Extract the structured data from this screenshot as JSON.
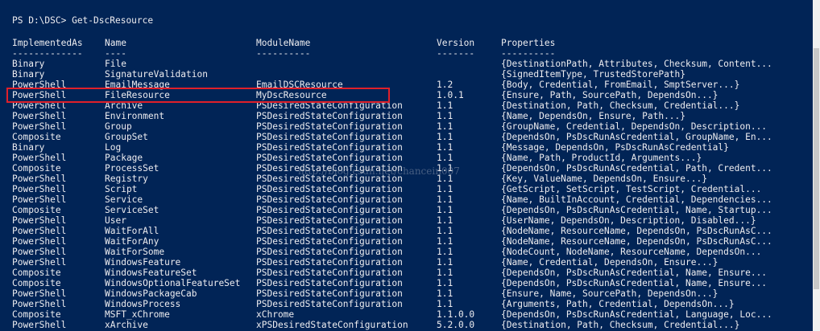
{
  "console": {
    "prompt": "PS D:\\DSC> Get-DscResource",
    "headers": [
      "ImplementedAs",
      "Name",
      "ModuleName",
      "Version",
      "Properties"
    ],
    "underlines": [
      "-------------",
      "----",
      "----------",
      "-------",
      "----------"
    ],
    "rows": [
      [
        "Binary",
        "File",
        "",
        "",
        "{DestinationPath, Attributes, Checksum, Content..."
      ],
      [
        "Binary",
        "SignatureValidation",
        "",
        "",
        "{SignedItemType, TrustedStorePath}"
      ],
      [
        "PowerShell",
        "EmailMessage",
        "EmailDSCResource",
        "1.2",
        "{Body, Credential, FromEmail, SmptServer...}"
      ],
      [
        "PowerShell",
        "FileResource",
        "MyDscResource",
        "1.0.1",
        "{Ensure, Path, SourcePath, DependsOn...}"
      ],
      [
        "PowerShell",
        "Archive",
        "PSDesiredStateConfiguration",
        "1.1",
        "{Destination, Path, Checksum, Credential...}"
      ],
      [
        "PowerShell",
        "Environment",
        "PSDesiredStateConfiguration",
        "1.1",
        "{Name, DependsOn, Ensure, Path...}"
      ],
      [
        "PowerShell",
        "Group",
        "PSDesiredStateConfiguration",
        "1.1",
        "{GroupName, Credential, DependsOn, Description..."
      ],
      [
        "Composite",
        "GroupSet",
        "PSDesiredStateConfiguration",
        "1.1",
        "{DependsOn, PsDscRunAsCredential, GroupName, En..."
      ],
      [
        "Binary",
        "Log",
        "PSDesiredStateConfiguration",
        "1.1",
        "{Message, DependsOn, PsDscRunAsCredential}"
      ],
      [
        "PowerShell",
        "Package",
        "PSDesiredStateConfiguration",
        "1.1",
        "{Name, Path, ProductId, Arguments...}"
      ],
      [
        "Composite",
        "ProcessSet",
        "PSDesiredStateConfiguration",
        "1.1",
        "{DependsOn, PsDscRunAsCredential, Path, Credent..."
      ],
      [
        "PowerShell",
        "Registry",
        "PSDesiredStateConfiguration",
        "1.1",
        "{Key, ValueName, DependsOn, Ensure...}"
      ],
      [
        "PowerShell",
        "Script",
        "PSDesiredStateConfiguration",
        "1.1",
        "{GetScript, SetScript, TestScript, Credential..."
      ],
      [
        "PowerShell",
        "Service",
        "PSDesiredStateConfiguration",
        "1.1",
        "{Name, BuiltInAccount, Credential, Dependencies..."
      ],
      [
        "Composite",
        "ServiceSet",
        "PSDesiredStateConfiguration",
        "1.1",
        "{DependsOn, PsDscRunAsCredential, Name, Startup..."
      ],
      [
        "PowerShell",
        "User",
        "PSDesiredStateConfiguration",
        "1.1",
        "{UserName, DependsOn, Description, Disabled...}"
      ],
      [
        "PowerShell",
        "WaitForAll",
        "PSDesiredStateConfiguration",
        "1.1",
        "{NodeName, ResourceName, DependsOn, PsDscRunAsC..."
      ],
      [
        "PowerShell",
        "WaitForAny",
        "PSDesiredStateConfiguration",
        "1.1",
        "{NodeName, ResourceName, DependsOn, PsDscRunAsC..."
      ],
      [
        "PowerShell",
        "WaitForSome",
        "PSDesiredStateConfiguration",
        "1.1",
        "{NodeCount, NodeName, ResourceName, DependsOn..."
      ],
      [
        "PowerShell",
        "WindowsFeature",
        "PSDesiredStateConfiguration",
        "1.1",
        "{Name, Credential, DependsOn, Ensure...}"
      ],
      [
        "Composite",
        "WindowsFeatureSet",
        "PSDesiredStateConfiguration",
        "1.1",
        "{DependsOn, PsDscRunAsCredential, Name, Ensure..."
      ],
      [
        "Composite",
        "WindowsOptionalFeatureSet",
        "PSDesiredStateConfiguration",
        "1.1",
        "{DependsOn, PsDscRunAsCredential, Name, Ensure..."
      ],
      [
        "PowerShell",
        "WindowsPackageCab",
        "PSDesiredStateConfiguration",
        "1.1",
        "{Ensure, Name, SourcePath, DependsOn...}"
      ],
      [
        "PowerShell",
        "WindowsProcess",
        "PSDesiredStateConfiguration",
        "1.1",
        "{Arguments, Path, Credential, DependsOn...}"
      ],
      [
        "Composite",
        "MSFT_xChrome",
        "xChrome",
        "1.1.0.0",
        "{DependsOn, PsDscRunAsCredential, Language, Loc..."
      ],
      [
        "PowerShell",
        "xArchive",
        "xPSDesiredStateConfiguration",
        "5.2.0.0",
        "{Destination, Path, Checksum, Credential...}"
      ]
    ],
    "highlighted_row": 3,
    "watermark": "http://blog.csdn.net/chancein007"
  },
  "colors": {
    "background": "#012456",
    "text": "#eeedf0",
    "highlight_border": "#e0202a"
  }
}
